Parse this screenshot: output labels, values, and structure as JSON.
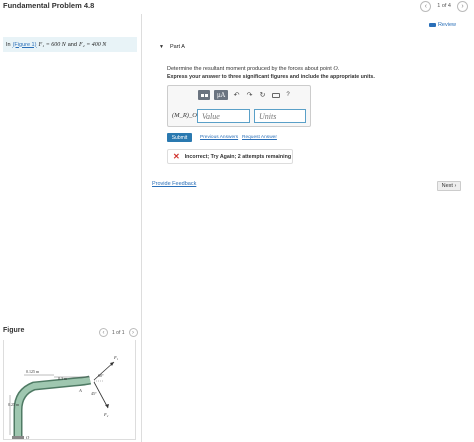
{
  "header": {
    "title": "Fundamental Problem 4.8",
    "pager_text": "1 of 4",
    "prev_icon": "chevron-left-icon",
    "next_icon": "chevron-right-icon"
  },
  "review": {
    "label": "Review",
    "icon": "review-icon"
  },
  "intro": {
    "prefix": "In",
    "figure_link": "(Figure 1)",
    "f1": "F₁ = 600 N",
    "and": "and",
    "f2": "F₂ = 400 N"
  },
  "part": {
    "label": "Part A",
    "question": "Determine the resultant moment produced by the forces about point",
    "point": "O.",
    "instructions": "Express your answer to three significant figures and include the appropriate units."
  },
  "answer": {
    "label": "(M_R)_O =",
    "value_placeholder": "Value",
    "units_placeholder": "Units",
    "toolbar_mu": "μA",
    "help": "?"
  },
  "actions": {
    "submit": "Submit",
    "previous_answers": "Previous Answers",
    "separator": "",
    "request_answer": "Request Answer"
  },
  "feedback": {
    "status": "Incorrect; Try Again; 2 attempts remaining",
    "provide_feedback": "Provide Feedback",
    "next": "Next ›"
  },
  "figure": {
    "title": "Figure",
    "pager_text": "1 of 1",
    "dim_top": "0.125 m",
    "dim_mid": "0.3 m",
    "dim_left": "0.25 m",
    "angle1": "60°",
    "angle2": "45°",
    "label_f1": "F₁",
    "label_f2": "F₂",
    "label_a": "A",
    "label_o": "O"
  },
  "colors": {
    "accent": "#2a79b0",
    "link": "#2a6fb8",
    "error": "#d0302b",
    "intro_bg": "#e8f3f7",
    "member": "#7fa892"
  }
}
